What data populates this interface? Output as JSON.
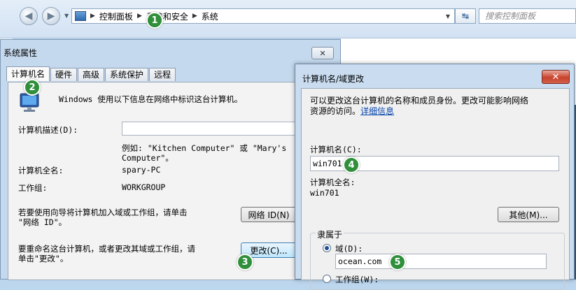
{
  "explorer": {
    "breadcrumb": [
      "控制面板",
      "系统和安全",
      "系统"
    ],
    "search_placeholder": "搜索控制面板"
  },
  "sys_props": {
    "title": "系统属性",
    "close_label": "✕",
    "tabs": [
      "计算机名",
      "硬件",
      "高级",
      "系统保护",
      "远程"
    ],
    "intro": "Windows 使用以下信息在网络中标识这台计算机。",
    "desc_label": "计算机描述(D):",
    "desc_example_line1": "例如: \"Kitchen Computer\" 或 \"Mary's",
    "desc_example_line2": "Computer\"。",
    "fullname_label": "计算机全名:",
    "fullname_value": "spary-PC",
    "workgroup_label": "工作组:",
    "workgroup_value": "WORKGROUP",
    "network_text_line1": "若要使用向导将计算机加入域或工作组，请单击",
    "network_text_line2": "\"网络 ID\"。",
    "network_button": "网络 ID(N)",
    "rename_text_line1": "要重命名这台计算机，或者更改其域或工作组，请",
    "rename_text_line2": "单击\"更改\"。",
    "change_button": "更改(C)..."
  },
  "name_dialog": {
    "title": "计算机名/域更改",
    "close_label": "✕",
    "intro_line1": "可以更改这台计算机的名称和成员身份。更改可能影响网络",
    "intro_line2_prefix": "资源的访问。",
    "more_info_link": "详细信息",
    "computer_name_label": "计算机名(C):",
    "computer_name_value": "win701",
    "fullname_label": "计算机全名:",
    "fullname_value": "win701",
    "other_button": "其他(M)...",
    "member_of_label": "隶属于",
    "domain_label": "域(D):",
    "domain_value": "ocean.com",
    "workgroup_label": "工作组(W):"
  },
  "steps": [
    "1",
    "2",
    "3",
    "4",
    "5"
  ],
  "colors": {
    "badge": "#2f8f3a",
    "link": "#0645ad",
    "close": "#c8432d"
  }
}
